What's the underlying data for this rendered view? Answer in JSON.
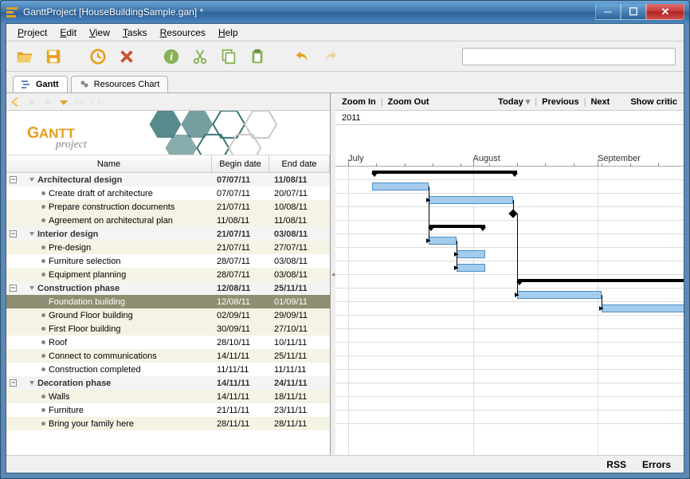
{
  "window": {
    "title": "GanttProject [HouseBuildingSample.gan] *"
  },
  "menu": [
    "Project",
    "Edit",
    "View",
    "Tasks",
    "Resources",
    "Help"
  ],
  "tabs": {
    "gantt": "Gantt",
    "resources": "Resources Chart"
  },
  "toolbar": {
    "open": "Open",
    "save": "Save",
    "time": "Time",
    "delete": "Delete",
    "info": "Info",
    "cut": "Cut",
    "copy": "Copy",
    "paste": "Paste",
    "undo": "Undo",
    "redo": "Redo"
  },
  "columns": {
    "name": "Name",
    "begin": "Begin date",
    "end": "End date"
  },
  "rview": {
    "zoom_in": "Zoom In",
    "zoom_out": "Zoom Out",
    "today": "Today",
    "previous": "Previous",
    "next": "Next",
    "critic": "Show critic",
    "year": "2011",
    "months": [
      "July",
      "August",
      "September"
    ]
  },
  "status": {
    "rss": "RSS",
    "errors": "Errors"
  },
  "tasks": [
    {
      "id": 1,
      "lvl": 0,
      "name": "Architectural design",
      "begin": "07/07/11",
      "end": "11/08/11",
      "sum": true,
      "style": "parent"
    },
    {
      "id": 2,
      "lvl": 1,
      "name": "Create draft of architecture",
      "begin": "07/07/11",
      "end": "20/07/11",
      "style": "childw"
    },
    {
      "id": 3,
      "lvl": 1,
      "name": "Prepare construction documents",
      "begin": "21/07/11",
      "end": "10/08/11",
      "style": "child"
    },
    {
      "id": 4,
      "lvl": 1,
      "name": "Agreement on architectural plan",
      "begin": "11/08/11",
      "end": "11/08/11",
      "ms": true,
      "style": "child"
    },
    {
      "id": 5,
      "lvl": 0,
      "name": "Interior design",
      "begin": "21/07/11",
      "end": "03/08/11",
      "sum": true,
      "style": "parent"
    },
    {
      "id": 6,
      "lvl": 1,
      "name": "Pre-design",
      "begin": "21/07/11",
      "end": "27/07/11",
      "style": "child"
    },
    {
      "id": 7,
      "lvl": 1,
      "name": "Furniture selection",
      "begin": "28/07/11",
      "end": "03/08/11",
      "style": "childw"
    },
    {
      "id": 8,
      "lvl": 1,
      "name": "Equipment planning",
      "begin": "28/07/11",
      "end": "03/08/11",
      "style": "child"
    },
    {
      "id": 9,
      "lvl": 0,
      "name": "Construction phase",
      "begin": "12/08/11",
      "end": "25/11/11",
      "sum": true,
      "style": "parent"
    },
    {
      "id": 10,
      "lvl": 1,
      "name": "Foundation building",
      "begin": "12/08/11",
      "end": "01/09/11",
      "style": "selected"
    },
    {
      "id": 11,
      "lvl": 1,
      "name": "Ground Floor building",
      "begin": "02/09/11",
      "end": "29/09/11",
      "style": "child"
    },
    {
      "id": 12,
      "lvl": 1,
      "name": "First Floor building",
      "begin": "30/09/11",
      "end": "27/10/11",
      "style": "child"
    },
    {
      "id": 13,
      "lvl": 1,
      "name": "Roof",
      "begin": "28/10/11",
      "end": "10/11/11",
      "style": "childw"
    },
    {
      "id": 14,
      "lvl": 1,
      "name": "Connect to communications",
      "begin": "14/11/11",
      "end": "25/11/11",
      "style": "child"
    },
    {
      "id": 15,
      "lvl": 1,
      "name": "Construction completed",
      "begin": "11/11/11",
      "end": "11/11/11",
      "ms": true,
      "style": "childw"
    },
    {
      "id": 16,
      "lvl": 0,
      "name": "Decoration phase",
      "begin": "14/11/11",
      "end": "24/11/11",
      "sum": true,
      "style": "parent"
    },
    {
      "id": 17,
      "lvl": 1,
      "name": "Walls",
      "begin": "14/11/11",
      "end": "18/11/11",
      "style": "child"
    },
    {
      "id": 18,
      "lvl": 1,
      "name": "Furniture",
      "begin": "21/11/11",
      "end": "23/11/11",
      "style": "childw"
    },
    {
      "id": 19,
      "lvl": 1,
      "name": "Bring your family here",
      "begin": "28/11/11",
      "end": "28/11/11",
      "style": "child"
    }
  ]
}
